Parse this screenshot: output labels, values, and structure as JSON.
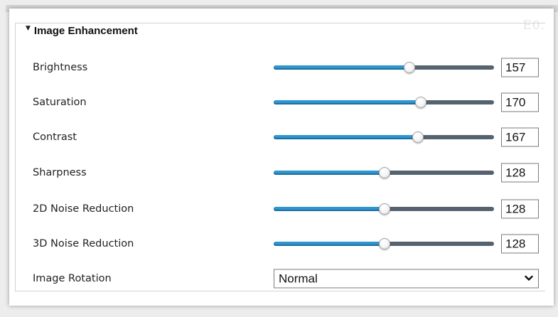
{
  "window": {
    "corner_text": "E0."
  },
  "section": {
    "title": "Image Enhancement",
    "collapse_icon": "caret-down-icon"
  },
  "sliders": [
    {
      "label": "Brightness",
      "value": "157",
      "fraction": 0.616
    },
    {
      "label": "Saturation",
      "value": "170",
      "fraction": 0.667
    },
    {
      "label": "Contrast",
      "value": "167",
      "fraction": 0.655
    },
    {
      "label": "Sharpness",
      "value": "128",
      "fraction": 0.502
    },
    {
      "label": "2D Noise Reduction",
      "value": "128",
      "fraction": 0.502
    },
    {
      "label": "3D Noise Reduction",
      "value": "128",
      "fraction": 0.502
    }
  ],
  "image_rotation": {
    "label": "Image Rotation",
    "value": "Normal",
    "icon": "chevron-down-icon"
  },
  "colors": {
    "slider_fill": "#2e95cf",
    "slider_track": "#556270"
  }
}
